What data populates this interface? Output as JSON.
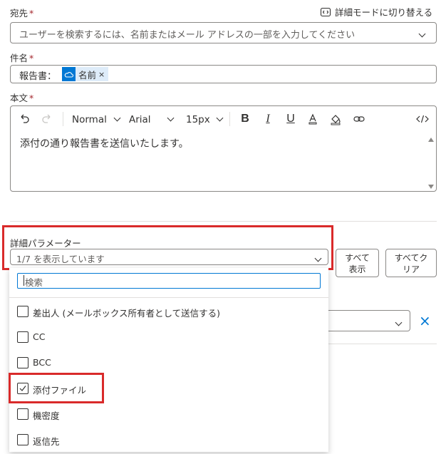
{
  "to": {
    "label": "宛先",
    "required": "*",
    "placeholder": "ユーザーを検索するには、名前またはメール アドレスの一部を入力してください",
    "advanced_link": "詳細モードに切り替える"
  },
  "subject": {
    "label": "件名",
    "required": "*",
    "prefix": "報告書：",
    "token_label": "名前",
    "token_remove": "×"
  },
  "body": {
    "label": "本文",
    "required": "*",
    "toolbar": {
      "style": "Normal",
      "font": "Arial",
      "size": "15px"
    },
    "text": "添付の通り報告書を送信いたします。"
  },
  "advanced": {
    "label": "詳細パラメーター",
    "selected_text": "1/7 を表示しています",
    "show_all_label_1": "すべて",
    "show_all_label_2": "表示",
    "clear_all_label_1": "すべてク",
    "clear_all_label_2": "リア"
  },
  "dropdown": {
    "search_placeholder": "検索",
    "options": [
      {
        "label": "差出人 (メールボックス所有者として送信する)",
        "checked": false
      },
      {
        "label": "CC",
        "checked": false
      },
      {
        "label": "BCC",
        "checked": false
      },
      {
        "label": "添付ファイル",
        "checked": true
      },
      {
        "label": "機密度",
        "checked": false
      },
      {
        "label": "返信先",
        "checked": false
      }
    ]
  },
  "colors": {
    "accent": "#0078d4",
    "highlight": "#d92a2a",
    "token_bg": "#deecf9"
  },
  "icons": {
    "remove": "×",
    "checkmark": "✓"
  }
}
